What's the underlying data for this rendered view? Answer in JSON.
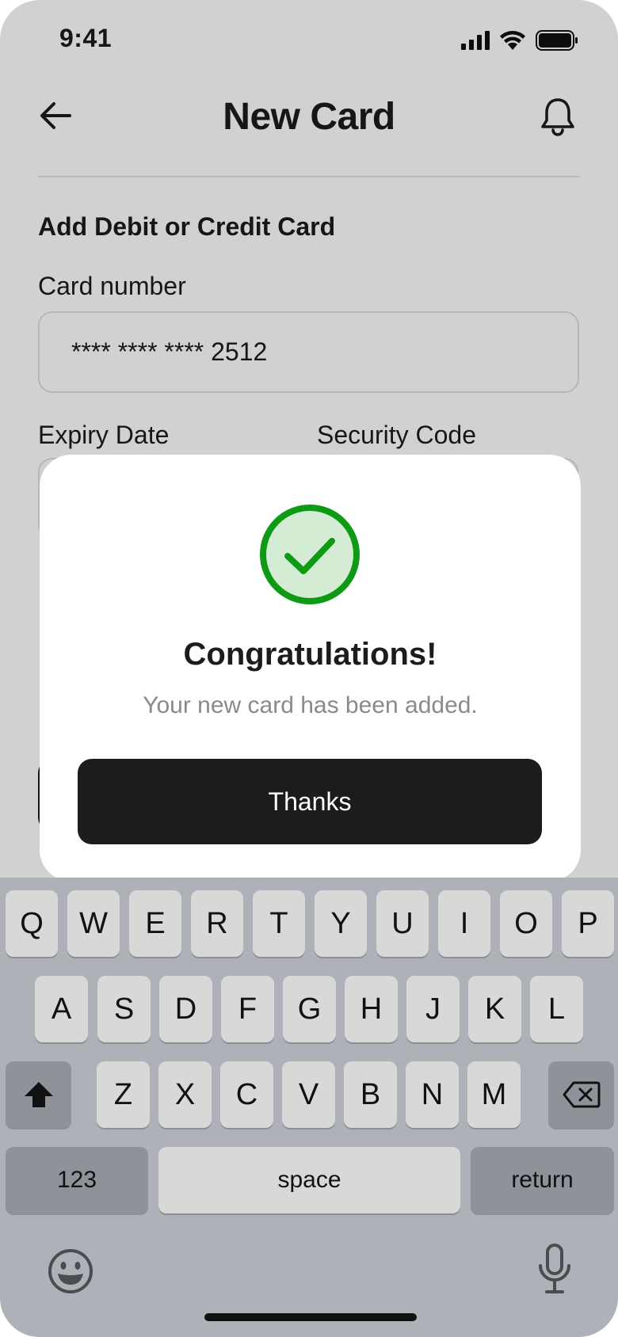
{
  "status_bar": {
    "time": "9:41"
  },
  "header": {
    "title": "New Card"
  },
  "form": {
    "section_title": "Add Debit or Credit Card",
    "card_number_label": "Card number",
    "card_number_value": "**** **** **** 2512",
    "expiry_label": "Expiry Date",
    "security_label": "Security Code"
  },
  "modal": {
    "title": "Congratulations!",
    "subtitle": "Your new card has been added.",
    "button_label": "Thanks",
    "accent_color": "#0e9a14",
    "accent_fill": "#d4ecd4"
  },
  "keyboard": {
    "row1": [
      "Q",
      "W",
      "E",
      "R",
      "T",
      "Y",
      "U",
      "I",
      "O",
      "P"
    ],
    "row2": [
      "A",
      "S",
      "D",
      "F",
      "G",
      "H",
      "J",
      "K",
      "L"
    ],
    "row3": [
      "Z",
      "X",
      "C",
      "V",
      "B",
      "N",
      "M"
    ],
    "numbers_label": "123",
    "space_label": "space",
    "return_label": "return"
  }
}
